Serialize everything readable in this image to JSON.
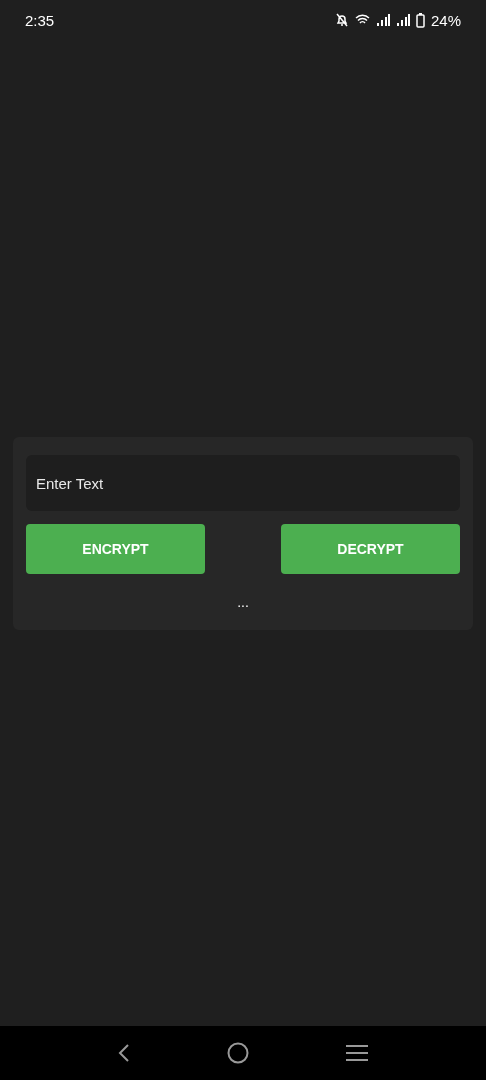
{
  "status_bar": {
    "time": "2:35",
    "battery": "24%"
  },
  "input": {
    "placeholder": "Enter Text"
  },
  "buttons": [
    {
      "label": "ENCRYPT"
    },
    {
      "label": "DECRYPT"
    }
  ],
  "result": "..."
}
